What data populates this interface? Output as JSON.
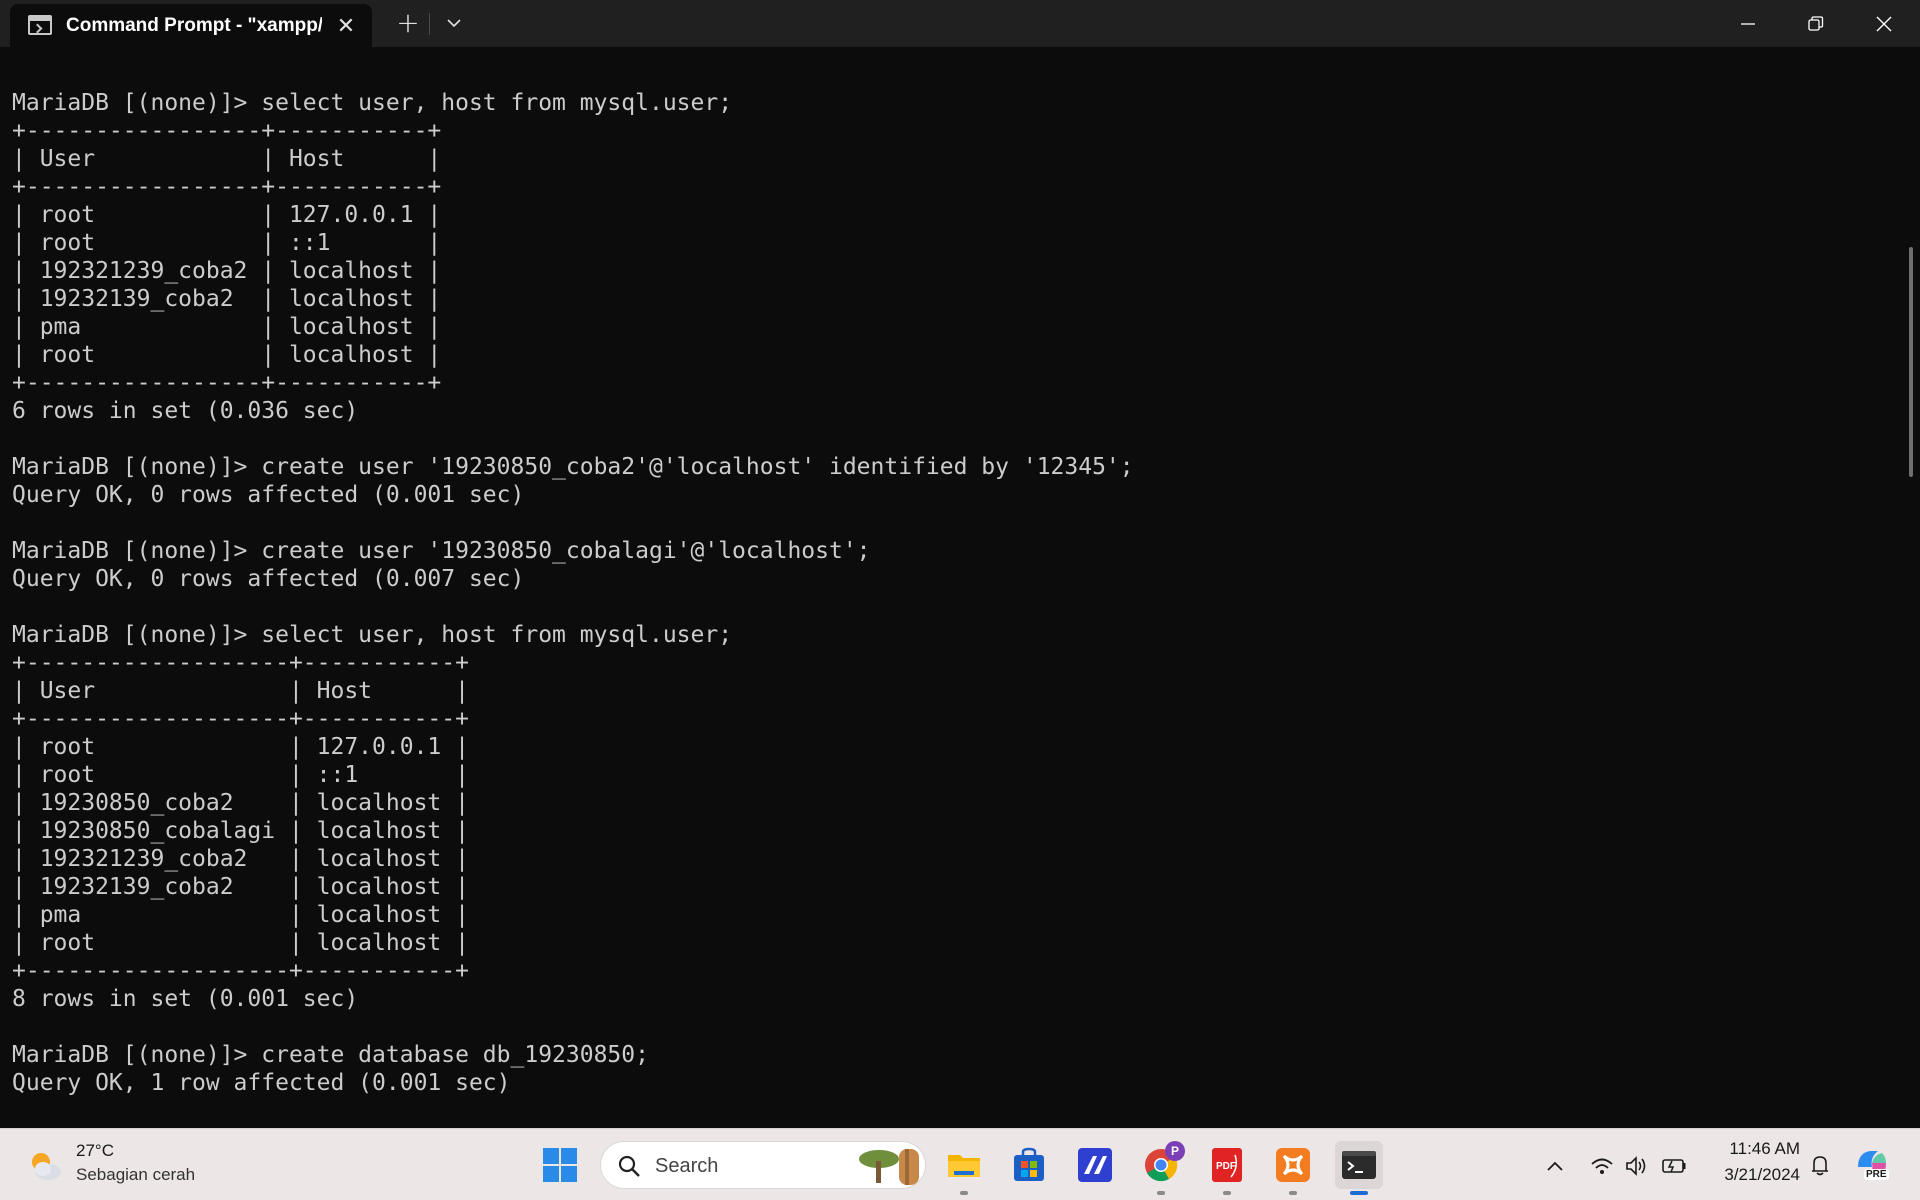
{
  "window": {
    "tab_title": "Command Prompt - \"xampp/mysql/bin/mysql.exe\"",
    "tab_close_glyph": "✕",
    "new_tab_glyph": "+",
    "controls": [
      "minimize-icon",
      "maximize-icon",
      "close-icon"
    ]
  },
  "terminal": {
    "lines": [
      "MariaDB [(none)]> select user, host from mysql.user;",
      "+-----------------+-----------+",
      "| User            | Host      |",
      "+-----------------+-----------+",
      "| root            | 127.0.0.1 |",
      "| root            | ::1       |",
      "| 192321239_coba2 | localhost |",
      "| 19232139_coba2  | localhost |",
      "| pma             | localhost |",
      "| root            | localhost |",
      "+-----------------+-----------+",
      "6 rows in set (0.036 sec)",
      "",
      "MariaDB [(none)]> create user '19230850_coba2'@'localhost' identified by '12345';",
      "Query OK, 0 rows affected (0.001 sec)",
      "",
      "MariaDB [(none)]> create user '19230850_cobalagi'@'localhost';",
      "Query OK, 0 rows affected (0.007 sec)",
      "",
      "MariaDB [(none)]> select user, host from mysql.user;",
      "+-------------------+-----------+",
      "| User              | Host      |",
      "+-------------------+-----------+",
      "| root              | 127.0.0.1 |",
      "| root              | ::1       |",
      "| 19230850_coba2    | localhost |",
      "| 19230850_cobalagi | localhost |",
      "| 192321239_coba2   | localhost |",
      "| 19232139_coba2    | localhost |",
      "| pma               | localhost |",
      "| root              | localhost |",
      "+-------------------+-----------+",
      "8 rows in set (0.001 sec)",
      "",
      "MariaDB [(none)]> create database db_19230850;",
      "Query OK, 1 row affected (0.001 sec)"
    ]
  },
  "taskbar": {
    "weather": {
      "temp": "27°C",
      "desc": "Sebagian cerah",
      "icon": "partly-sunny-icon"
    },
    "search": {
      "placeholder": "Search"
    },
    "apps": [
      {
        "name": "start-button",
        "icon": "windows-logo-icon"
      },
      {
        "name": "file-explorer-app",
        "icon": "folder-icon"
      },
      {
        "name": "microsoft-store-app",
        "icon": "store-icon"
      },
      {
        "name": "visual-studio-app",
        "icon": "vs-icon"
      },
      {
        "name": "chrome-app",
        "icon": "chrome-icon",
        "badge": "P"
      },
      {
        "name": "pdf-reader-app",
        "icon": "pdf-icon",
        "label": "PDF"
      },
      {
        "name": "xampp-app",
        "icon": "xampp-icon"
      },
      {
        "name": "terminal-app",
        "icon": "terminal-icon"
      }
    ],
    "tray": {
      "icons": [
        "chevron-up-icon",
        "wifi-icon",
        "volume-icon",
        "battery-icon"
      ],
      "time": "11:46 AM",
      "date": "3/21/2024",
      "copilot_badge": "PRE"
    },
    "colors": {
      "accent": "#1f6bd6",
      "taskbar_bg": "#ece6e6",
      "terminal_bg": "#0c0c0c",
      "terminal_fg": "#cccccc"
    }
  }
}
